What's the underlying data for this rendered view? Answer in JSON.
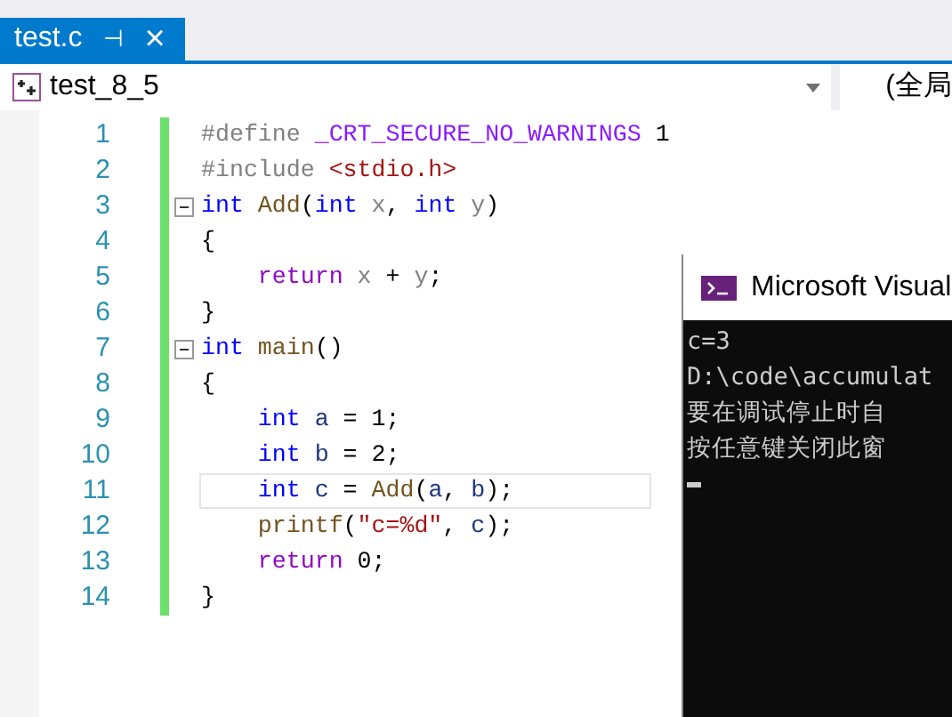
{
  "tab": {
    "title": "test.c",
    "pin": "⊣",
    "close": "×",
    "selected": true
  },
  "nav": {
    "scope": "test_8_5",
    "context": "(全局"
  },
  "lines": [
    {
      "number": "1",
      "foldable": false,
      "selected": false,
      "tokens": [
        {
          "kind": "preproc",
          "text": "#define "
        },
        {
          "kind": "macro",
          "text": "_CRT_SECURE_NO_WARNINGS"
        },
        {
          "kind": "plain",
          "text": " 1"
        }
      ]
    },
    {
      "number": "2",
      "foldable": false,
      "selected": false,
      "tokens": [
        {
          "kind": "preproc",
          "text": "#include "
        },
        {
          "kind": "string",
          "text": "<stdio.h>"
        }
      ]
    },
    {
      "number": "3",
      "foldable": true,
      "selected": false,
      "tokens": [
        {
          "kind": "keyword",
          "text": "int"
        },
        {
          "kind": "function",
          "text": " Add"
        },
        {
          "kind": "plain",
          "text": "("
        },
        {
          "kind": "keyword",
          "text": "int"
        },
        {
          "kind": "param",
          "text": " x"
        },
        {
          "kind": "plain",
          "text": ", "
        },
        {
          "kind": "keyword",
          "text": "int"
        },
        {
          "kind": "param",
          "text": " y"
        },
        {
          "kind": "plain",
          "text": ")"
        }
      ]
    },
    {
      "number": "4",
      "foldable": false,
      "selected": false,
      "tokens": [
        {
          "kind": "plain",
          "text": "{"
        }
      ]
    },
    {
      "number": "5",
      "foldable": false,
      "selected": false,
      "tokens": [
        {
          "kind": "control",
          "text": "    return"
        },
        {
          "kind": "param",
          "text": " x"
        },
        {
          "kind": "plain",
          "text": " + "
        },
        {
          "kind": "param",
          "text": "y"
        },
        {
          "kind": "plain",
          "text": ";"
        }
      ]
    },
    {
      "number": "6",
      "foldable": false,
      "selected": false,
      "tokens": [
        {
          "kind": "plain",
          "text": "}"
        }
      ]
    },
    {
      "number": "7",
      "foldable": true,
      "selected": false,
      "tokens": [
        {
          "kind": "keyword",
          "text": "int"
        },
        {
          "kind": "function",
          "text": " main"
        },
        {
          "kind": "plain",
          "text": "()"
        }
      ]
    },
    {
      "number": "8",
      "foldable": false,
      "selected": false,
      "tokens": [
        {
          "kind": "plain",
          "text": "{"
        }
      ]
    },
    {
      "number": "9",
      "foldable": false,
      "selected": false,
      "tokens": [
        {
          "kind": "keyword",
          "text": "    int"
        },
        {
          "kind": "local",
          "text": " a"
        },
        {
          "kind": "plain",
          "text": " = 1;"
        }
      ]
    },
    {
      "number": "10",
      "foldable": false,
      "selected": false,
      "tokens": [
        {
          "kind": "keyword",
          "text": "    int"
        },
        {
          "kind": "local",
          "text": " b"
        },
        {
          "kind": "plain",
          "text": " = 2;"
        }
      ]
    },
    {
      "number": "11",
      "foldable": false,
      "selected": true,
      "tokens": [
        {
          "kind": "keyword",
          "text": "    int"
        },
        {
          "kind": "local",
          "text": " c"
        },
        {
          "kind": "plain",
          "text": " = "
        },
        {
          "kind": "function",
          "text": "Add"
        },
        {
          "kind": "plain",
          "text": "("
        },
        {
          "kind": "local",
          "text": "a"
        },
        {
          "kind": "plain",
          "text": ", "
        },
        {
          "kind": "local",
          "text": "b"
        },
        {
          "kind": "plain",
          "text": ");"
        }
      ]
    },
    {
      "number": "12",
      "foldable": false,
      "selected": false,
      "tokens": [
        {
          "kind": "function",
          "text": "    printf"
        },
        {
          "kind": "plain",
          "text": "("
        },
        {
          "kind": "string",
          "text": "\"c=%d\""
        },
        {
          "kind": "plain",
          "text": ", "
        },
        {
          "kind": "local",
          "text": "c"
        },
        {
          "kind": "plain",
          "text": ");"
        }
      ]
    },
    {
      "number": "13",
      "foldable": false,
      "selected": false,
      "tokens": [
        {
          "kind": "control",
          "text": "    return"
        },
        {
          "kind": "plain",
          "text": " 0;"
        }
      ]
    },
    {
      "number": "14",
      "foldable": false,
      "selected": false,
      "tokens": [
        {
          "kind": "plain",
          "text": "}"
        }
      ]
    }
  ],
  "console": {
    "title": "Microsoft Visual",
    "lines": [
      "c=3",
      "D:\\code\\accumulat",
      "要在调试停止时自",
      "按任意键关闭此窗"
    ]
  }
}
